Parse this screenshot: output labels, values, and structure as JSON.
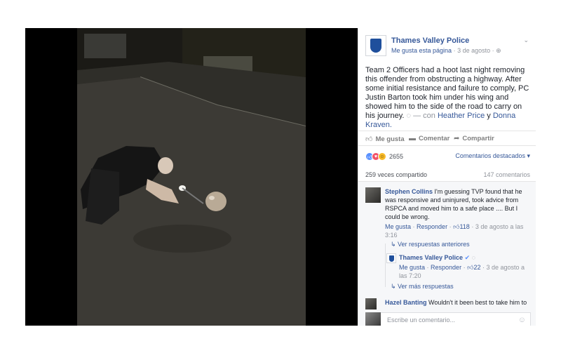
{
  "page": {
    "name": "Thames Valley Police",
    "like_link": "Me gusta esta página",
    "date": "3 de agosto",
    "privacy_icon": "globe-icon"
  },
  "post": {
    "text": "Team 2 Officers had a hoot last night removing this offender from obstructing a highway. After some initial resistance and failure to comply, PC Justin Barton took him under his wing and showed him to the side of the road to carry on his journey.",
    "with": "— con",
    "tag1": "Heather Price",
    "and": "y",
    "tag2": "Donna Kraven."
  },
  "actions": {
    "like": "Me gusta",
    "comment": "Comentar",
    "share": "Compartir"
  },
  "reactions": {
    "count": "2655",
    "filter": "Comentarios destacados"
  },
  "stats": {
    "shares": "259 veces compartido",
    "comments": "147 comentarios"
  },
  "comments": [
    {
      "author": "Stephen Collins",
      "text": "I'm guessing TVP found that he was responsive and uninjured, took advice from RSPCA and moved him to a safe place .... But I could be wrong.",
      "like": "Me gusta",
      "reply": "Responder",
      "likes": "118",
      "time": "3 de agosto a las 3:16"
    },
    {
      "author": "Hazel Banting",
      "text": "Wouldn't it been best to take him to"
    }
  ],
  "replies": {
    "previous": "Ver respuestas anteriores",
    "author": "Thames Valley Police",
    "like": "Me gusta",
    "reply": "Responder",
    "likes": "22",
    "time": "3 de agosto a las 7:20",
    "more": "Ver más respuestas"
  },
  "composer": {
    "placeholder": "Escribe un comentario..."
  },
  "colors": {
    "link": "#365899",
    "accent_like": "#5890ff"
  }
}
